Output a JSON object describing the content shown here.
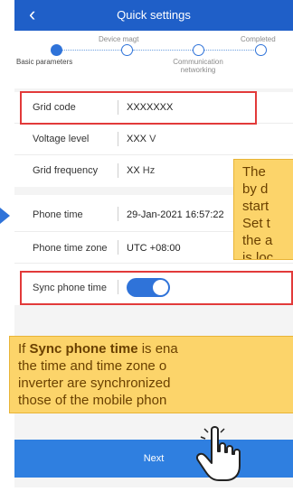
{
  "header": {
    "title": "Quick settings",
    "back_glyph": "‹"
  },
  "stepper": {
    "steps": [
      {
        "label": "Basic parameters",
        "state": "active"
      },
      {
        "label": "Device magt",
        "state": "pending"
      },
      {
        "label": "Communication networking",
        "state": "pending"
      },
      {
        "label": "Completed",
        "state": "pending"
      }
    ]
  },
  "fields": {
    "grid_code": {
      "label": "Grid code",
      "value": "XXXXXXX"
    },
    "voltage_level": {
      "label": "Voltage level",
      "value": "XXX",
      "unit": "V"
    },
    "grid_frequency": {
      "label": "Grid frequency",
      "value": "XX",
      "unit": "Hz"
    },
    "phone_time": {
      "label": "Phone time",
      "value": "29-Jan-2021 16:57:22"
    },
    "phone_time_zone": {
      "label": "Phone time zone",
      "value": "UTC +08:00"
    },
    "sync_phone_time": {
      "label": "Sync phone time",
      "enabled": true
    }
  },
  "callout_top": {
    "lines": [
      "The",
      "by d",
      "start",
      "Set t",
      "the a",
      "is loc"
    ]
  },
  "callout_bottom": {
    "line1_pre": "If ",
    "line1_bold": "Sync phone time",
    "line1_post": " is ena",
    "line2": "the time and time zone o",
    "line3": "inverter are synchronized",
    "line4": "those of the mobile phon"
  },
  "next_button": {
    "label": "Next"
  },
  "colors": {
    "header": "#1f5fc8",
    "accent": "#2f73d9",
    "highlight": "#e23a3a",
    "note_bg": "#fcd46a"
  }
}
